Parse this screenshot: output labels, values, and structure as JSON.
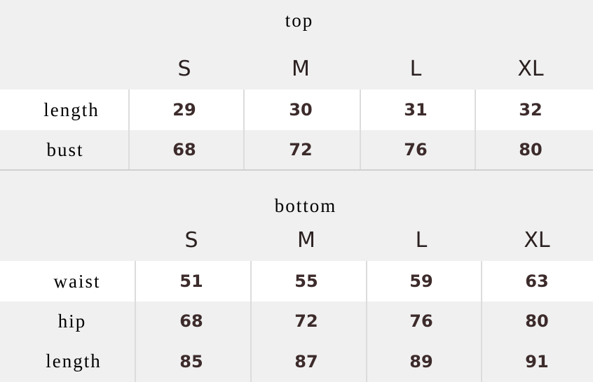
{
  "top": {
    "title": "top",
    "sizes": [
      "S",
      "M",
      "L",
      "XL"
    ],
    "rows": [
      {
        "label": "length",
        "values": [
          "29",
          "30",
          "31",
          "32"
        ]
      },
      {
        "label": "bust",
        "values": [
          "68",
          "72",
          "76",
          "80"
        ]
      }
    ]
  },
  "bottom": {
    "title": "bottom",
    "sizes": [
      "S",
      "M",
      "L",
      "XL"
    ],
    "rows": [
      {
        "label": "waist",
        "values": [
          "51",
          "55",
          "59",
          "63"
        ]
      },
      {
        "label": "hip",
        "values": [
          "68",
          "72",
          "76",
          "80"
        ]
      },
      {
        "label": "length",
        "values": [
          "85",
          "87",
          "89",
          "91"
        ]
      }
    ]
  },
  "colors": {
    "background": "#f0f0f0",
    "highlight_row": "#ffffff",
    "value_text": "#3d2b2b"
  }
}
